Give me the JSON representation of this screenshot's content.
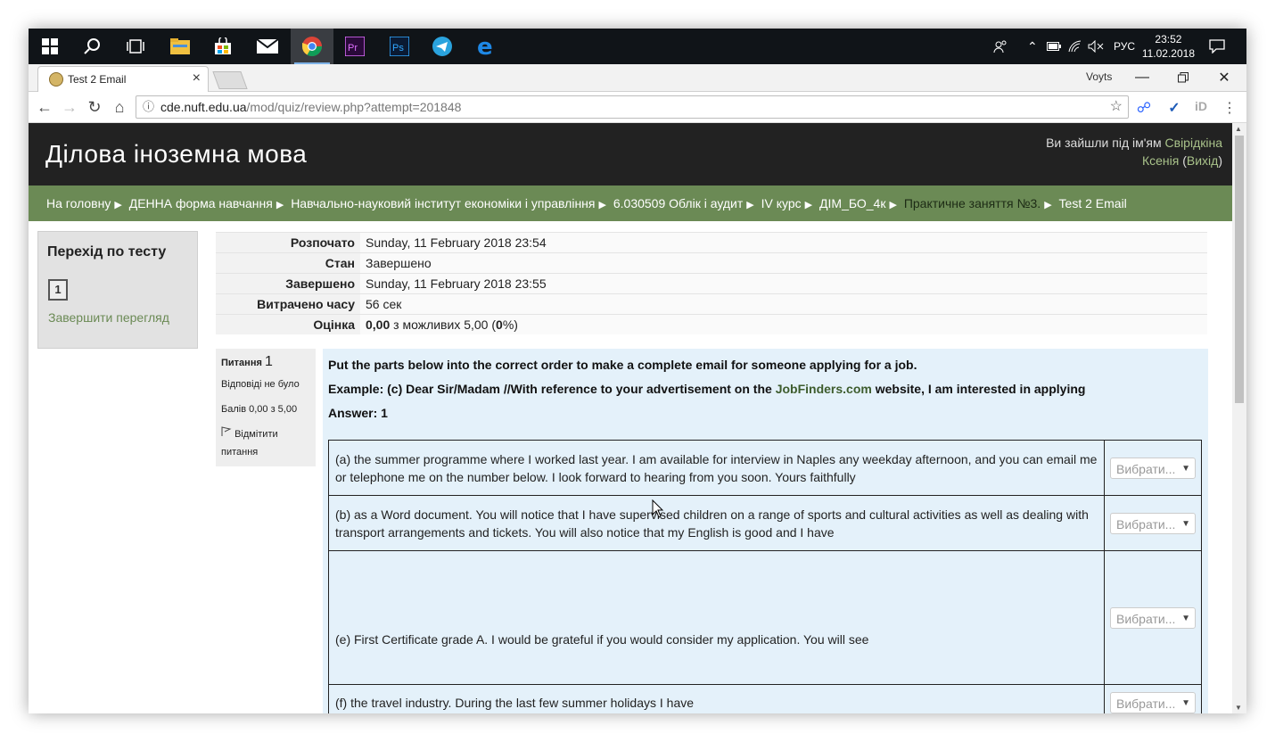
{
  "taskbar": {
    "tray": {
      "lang": "РУС",
      "time": "23:52",
      "date": "11.02.2018"
    }
  },
  "browser": {
    "tab_title": "Test 2 Email",
    "profile": "Voyts",
    "url_host": "cde.nuft.edu.ua",
    "url_rest": "/mod/quiz/review.php?attempt=201848"
  },
  "header": {
    "title": "Ділова іноземна мова",
    "login_prefix": "Ви зайшли під ім'ям ",
    "user_first": "Свірідкіна",
    "user_last": "Ксенія",
    "logout": "Вихід"
  },
  "breadcrumb": [
    "На головну",
    "ДЕННА форма навчання",
    "Навчально-науковий інститут економіки і управління",
    "6.030509 Облік і аудит",
    "IV курс",
    "ДІМ_БО_4к",
    "Практичне заняття №3.",
    "Test 2 Email"
  ],
  "quiz_nav": {
    "title": "Перехід по тесту",
    "question_number": "1",
    "finish_review": "Завершити перегляд"
  },
  "summary": [
    {
      "key": "Розпочато",
      "value": "Sunday, 11 February 2018 23:54"
    },
    {
      "key": "Стан",
      "value": "Завершено"
    },
    {
      "key": "Завершено",
      "value": "Sunday, 11 February 2018 23:55"
    },
    {
      "key": "Витрачено часу",
      "value": "56 сек"
    }
  ],
  "grade": {
    "key": "Оцінка",
    "score": "0,00",
    "middle": " з можливих 5,00 (",
    "percent": "0",
    "end": "%)"
  },
  "question_info": {
    "label": "Питання",
    "number": "1",
    "state": "Відповіді не було",
    "marks": "Балів 0,00 з 5,00",
    "flag": "Відмітити питання"
  },
  "question": {
    "line1": "Put the parts below into the correct order to make a complete email for someone applying for a job.",
    "example_prefix": "Example: (c) Dear Sir/Madam //With reference to your advertisement on the ",
    "example_link": "JobFinders.com",
    "example_suffix": " website, I am interested in applying",
    "answer": "Answer: 1",
    "select_placeholder": "Вибрати...",
    "options": [
      "(a) the summer programme where I worked last year. I am available for interview in Naples any weekday afternoon, and you can email me or telephone me on the number below. I look forward to hearing from you soon. Yours faithfully",
      "(b) as a Word document. You will notice that I have supervised children on a range of sports and cultural activities as well as dealing with transport arrangements and tickets. You will also notice that my English is good and I have",
      "(e) First Certificate grade A. I would be grateful if you would consider my application. You will see",
      "(f) the travel industry. During the last few summer holidays I have"
    ]
  }
}
